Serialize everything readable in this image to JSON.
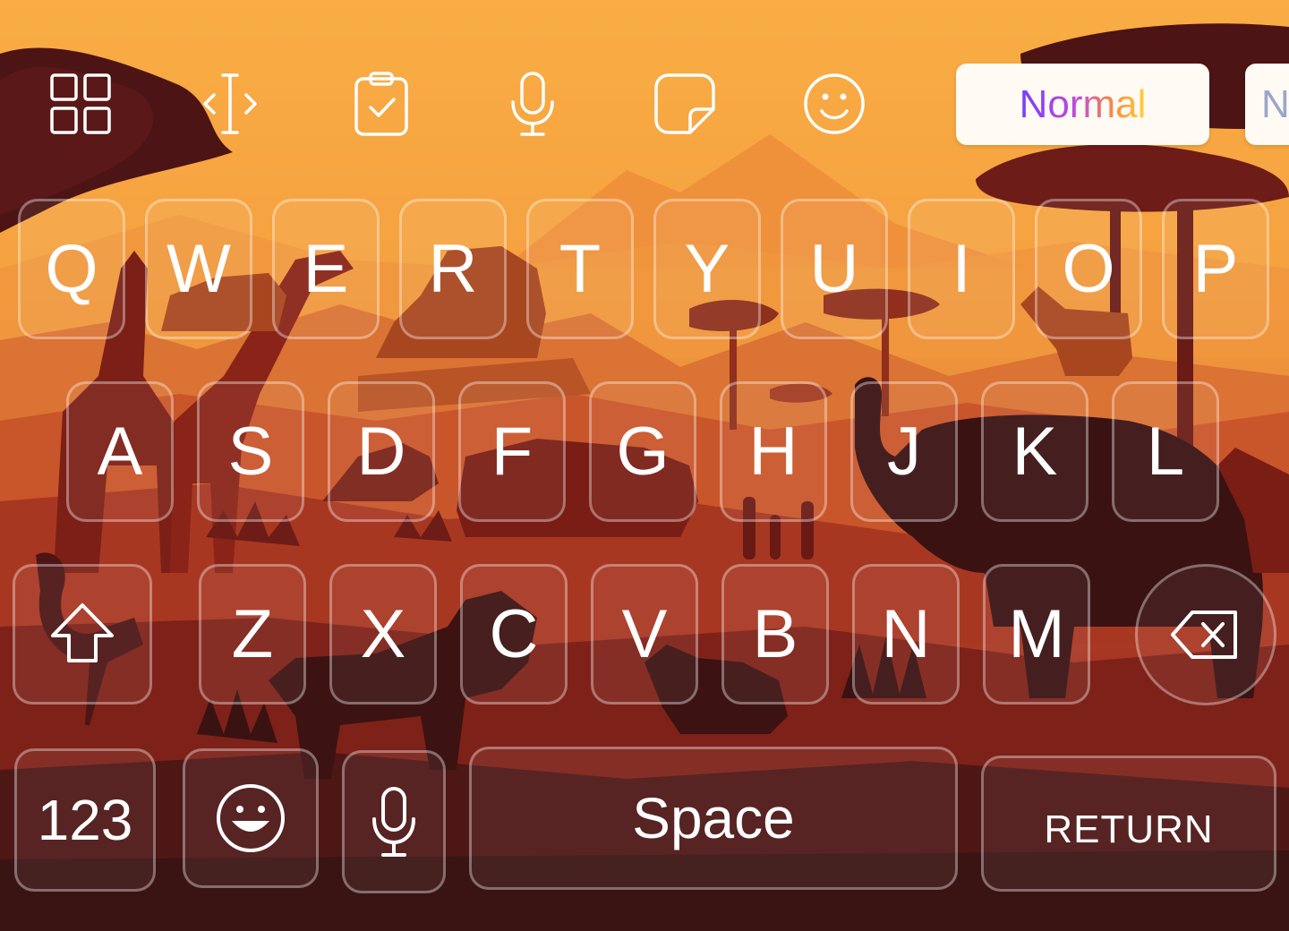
{
  "toolbar": {
    "icons": [
      "apps-grid-icon",
      "text-cursor-icon",
      "clipboard-icon",
      "microphone-icon",
      "sticker-icon",
      "smiley-icon"
    ],
    "chips": [
      {
        "label": "Normal",
        "selected": true
      },
      {
        "label": "N",
        "selected": false
      }
    ]
  },
  "keys": {
    "row1": [
      "Q",
      "W",
      "E",
      "R",
      "T",
      "Y",
      "U",
      "I",
      "O",
      "P"
    ],
    "row2": [
      "A",
      "S",
      "D",
      "F",
      "G",
      "H",
      "J",
      "K",
      "L"
    ],
    "row3": [
      "Z",
      "X",
      "C",
      "V",
      "B",
      "N",
      "M"
    ]
  },
  "bottom_row": {
    "numbers_label": "123",
    "emoji_icon": "emoji-icon",
    "mic_icon": "microphone-icon",
    "space_label": "Space",
    "return_label": "RETURN"
  },
  "special_keys": {
    "shift_icon": "shift-icon",
    "delete_icon": "backspace-icon"
  },
  "theme": {
    "name": "Savanna sunset",
    "sky_top": "#f9ad44",
    "sky_mid": "#f39a3f",
    "ground_dark": "#3a1413",
    "silhouette": "#8a2a1c",
    "key_border": "rgba(255,255,255,0.35)",
    "key_text": "#ffffff"
  }
}
